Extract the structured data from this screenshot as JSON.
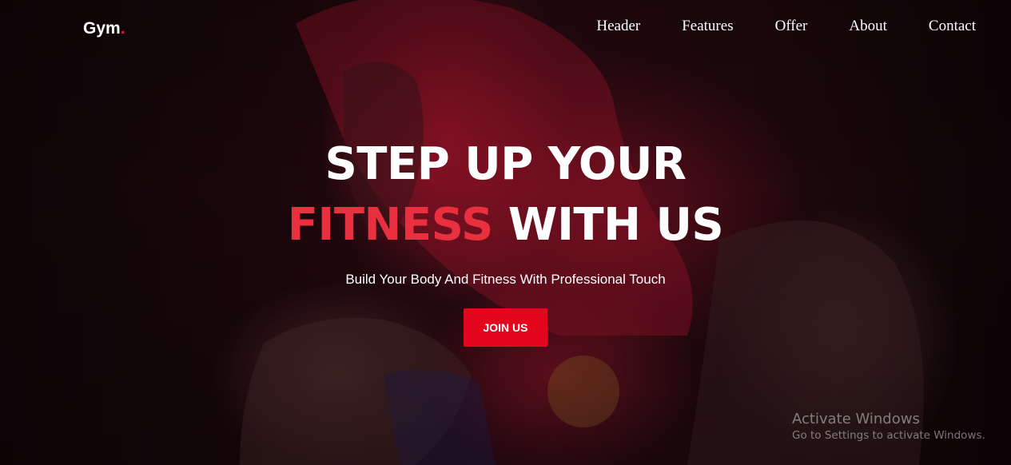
{
  "brand": {
    "name": "Gym",
    "dot": "."
  },
  "nav": {
    "items": [
      {
        "label": "Header"
      },
      {
        "label": "Features"
      },
      {
        "label": "Offer"
      },
      {
        "label": "About"
      },
      {
        "label": "Contact"
      }
    ]
  },
  "hero": {
    "line1": "STEP UP YOUR",
    "accent": "FITNESS",
    "line2_rest": " WITH US",
    "subtitle": "Build Your Body And Fitness With Professional Touch",
    "cta_label": "JOIN US"
  },
  "watermark": {
    "title": "Activate Windows",
    "subtitle": "Go to Settings to activate Windows."
  },
  "colors": {
    "accent": "#e8303f",
    "button": "#e3061c",
    "text": "#ffffff"
  }
}
